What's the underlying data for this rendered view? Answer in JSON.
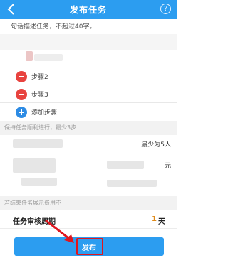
{
  "header": {
    "title": "发布任务",
    "help_glyph": "?"
  },
  "form": {
    "task_hint": "一句话描述任务，不超过40字。",
    "steps": [
      {
        "label": "步骤2"
      },
      {
        "label": "步骤3"
      }
    ],
    "add_step_label": "添加步骤",
    "order_hint": "保持任务顺利进行，最少3步",
    "min_people_text": "最少为5人",
    "yuan_unit": "元",
    "end_hint": "若结束任务展示费用不",
    "review_period": {
      "label": "任务审核周期",
      "value": "1",
      "unit": "天"
    }
  },
  "footer": {
    "publish_label": "发布"
  },
  "colors": {
    "primary": "#2c9df0",
    "remove": "#e8433f",
    "add": "#2d8be4",
    "highlight": "#e0161e",
    "value_accent": "#e08a17"
  }
}
